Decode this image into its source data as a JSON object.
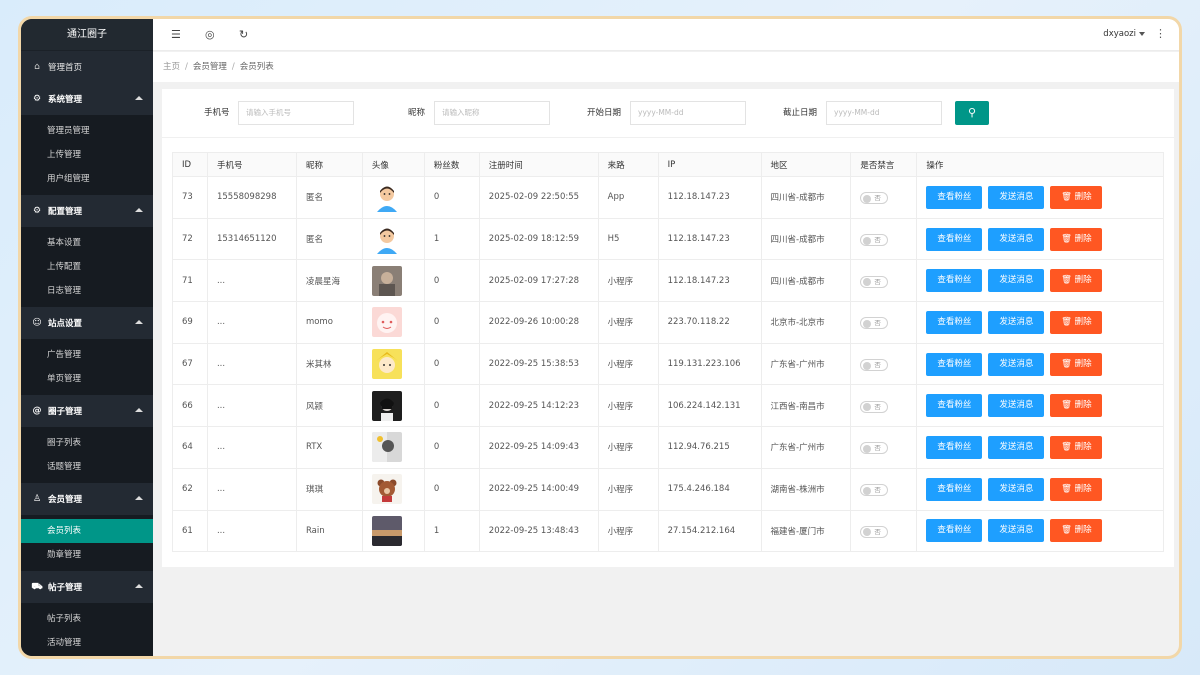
{
  "sidebar": {
    "logo": "通江圈子",
    "home": {
      "label": "管理首页",
      "icon": "home-icon"
    },
    "groups": [
      {
        "label": "系统管理",
        "icon": "gear-icon",
        "items": [
          "管理员管理",
          "上传管理",
          "用户组管理"
        ]
      },
      {
        "label": "配置管理",
        "icon": "settings-icon",
        "items": [
          "基本设置",
          "上传配置",
          "日志管理"
        ]
      },
      {
        "label": "站点设置",
        "icon": "smile-icon",
        "items": [
          "广告管理",
          "单页管理"
        ]
      },
      {
        "label": "圈子管理",
        "icon": "at-icon",
        "items": [
          "圈子列表",
          "话题管理"
        ]
      },
      {
        "label": "会员管理",
        "icon": "user-icon",
        "items": [
          "会员列表",
          "勋章管理"
        ]
      },
      {
        "label": "帖子管理",
        "icon": "cart-icon",
        "items": [
          "帖子列表",
          "活动管理"
        ]
      }
    ],
    "active_item": "会员列表"
  },
  "header": {
    "user": "dxyaozi"
  },
  "breadcrumb": [
    "主页",
    "会员管理",
    "会员列表"
  ],
  "filter": {
    "phone_label": "手机号",
    "phone_placeholder": "请输入手机号",
    "nick_label": "昵称",
    "nick_placeholder": "请输入昵称",
    "start_label": "开始日期",
    "start_placeholder": "yyyy-MM-dd",
    "end_label": "截止日期",
    "end_placeholder": "yyyy-MM-dd"
  },
  "table": {
    "headers": [
      "ID",
      "手机号",
      "昵称",
      "头像",
      "粉丝数",
      "注册时间",
      "来路",
      "IP",
      "地区",
      "是否禁言",
      "操作"
    ],
    "toggle_label": "否",
    "btn_fans": "查看粉丝",
    "btn_msg": "发送消息",
    "btn_delete": "删除",
    "rows": [
      {
        "id": "73",
        "phone": "15558098298",
        "nick": "匿名",
        "avatar": "avatar-boy",
        "fans": "0",
        "time": "2025-02-09 22:50:55",
        "source": "App",
        "ip": "112.18.147.23",
        "region": "四川省-成都市"
      },
      {
        "id": "72",
        "phone": "15314651120",
        "nick": "匿名",
        "avatar": "avatar-boy",
        "fans": "1",
        "time": "2025-02-09 18:12:59",
        "source": "H5",
        "ip": "112.18.147.23",
        "region": "四川省-成都市"
      },
      {
        "id": "71",
        "phone": "...",
        "nick": "凌晨星海",
        "avatar": "avatar-photo",
        "fans": "0",
        "time": "2025-02-09 17:27:28",
        "source": "小程序",
        "ip": "112.18.147.23",
        "region": "四川省-成都市"
      },
      {
        "id": "69",
        "phone": "...",
        "nick": "momo",
        "avatar": "avatar-pink",
        "fans": "0",
        "time": "2022-09-26 10:00:28",
        "source": "小程序",
        "ip": "223.70.118.22",
        "region": "北京市-北京市"
      },
      {
        "id": "67",
        "phone": "...",
        "nick": "米其林",
        "avatar": "avatar-yellow",
        "fans": "0",
        "time": "2022-09-25 15:38:53",
        "source": "小程序",
        "ip": "119.131.223.106",
        "region": "广东省-广州市"
      },
      {
        "id": "66",
        "phone": "...",
        "nick": "风颍",
        "avatar": "avatar-dark",
        "fans": "0",
        "time": "2022-09-25 14:12:23",
        "source": "小程序",
        "ip": "106.224.142.131",
        "region": "江西省-南昌市"
      },
      {
        "id": "64",
        "phone": "...",
        "nick": "RTX",
        "avatar": "avatar-gray",
        "fans": "0",
        "time": "2022-09-25 14:09:43",
        "source": "小程序",
        "ip": "112.94.76.215",
        "region": "广东省-广州市"
      },
      {
        "id": "62",
        "phone": "...",
        "nick": "琪琪",
        "avatar": "avatar-bear",
        "fans": "0",
        "time": "2022-09-25 14:00:49",
        "source": "小程序",
        "ip": "175.4.246.184",
        "region": "湖南省-株洲市"
      },
      {
        "id": "61",
        "phone": "...",
        "nick": "Rain",
        "avatar": "avatar-sunset",
        "fans": "1",
        "time": "2022-09-25 13:48:43",
        "source": "小程序",
        "ip": "27.154.212.164",
        "region": "福建省-厦门市"
      }
    ]
  },
  "colors": {
    "accent": "#009688",
    "blue": "#1e9fff",
    "red": "#ff5722",
    "sidebar": "#232a33"
  }
}
